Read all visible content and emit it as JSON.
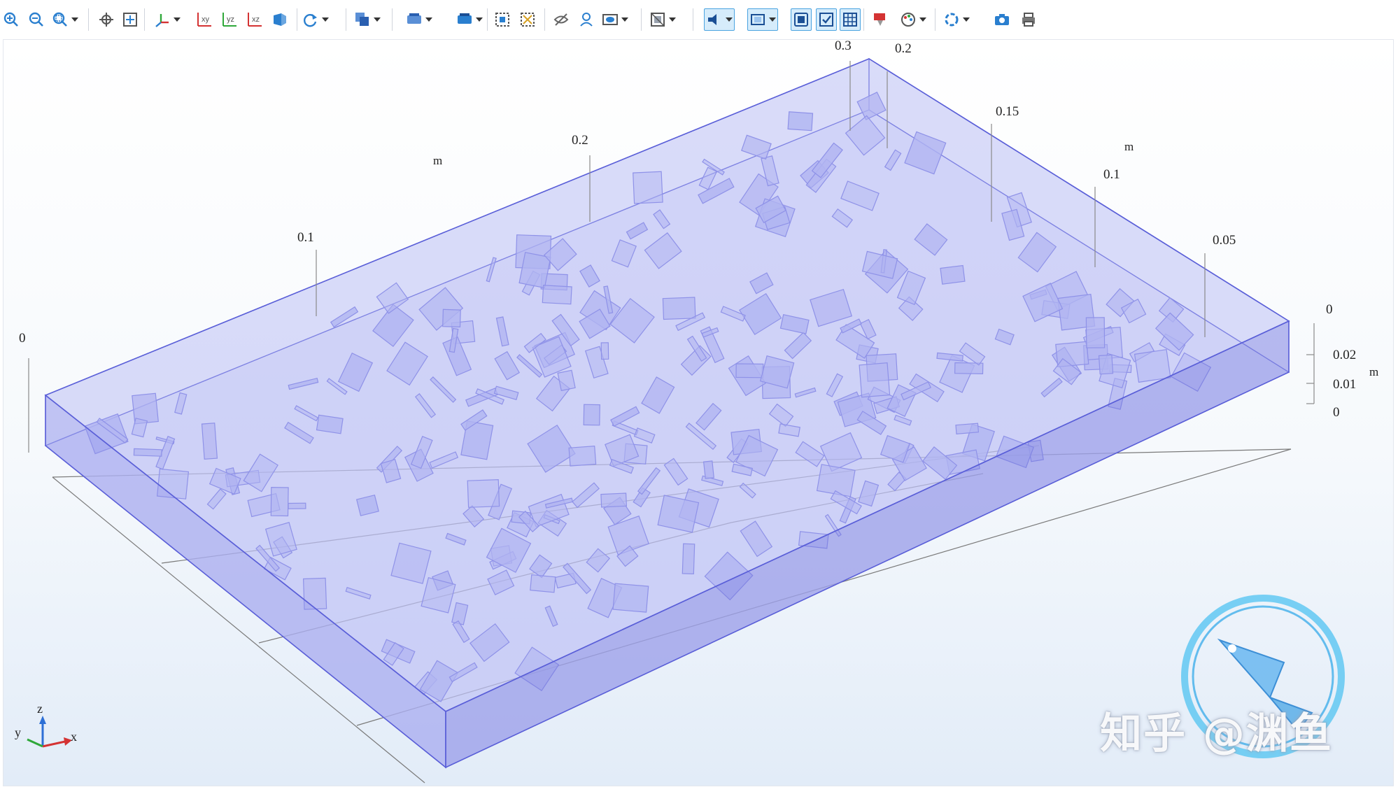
{
  "toolbar": {
    "buttons": [
      {
        "name": "zoom-in-button",
        "icon": "zoom-in-icon"
      },
      {
        "name": "zoom-out-button",
        "icon": "zoom-out-icon"
      },
      {
        "name": "zoom-box-button",
        "icon": "zoom-box-icon",
        "dropdown": true
      },
      {
        "name": "go-to-default-view-button",
        "icon": "center-view-icon"
      },
      {
        "name": "zoom-extents-button",
        "icon": "zoom-extents-icon"
      },
      {
        "name": "view-orientation-button",
        "icon": "axis-orientation-icon",
        "dropdown": true
      },
      {
        "name": "xy-view-button",
        "icon": "xy-plane-icon",
        "label": "xy"
      },
      {
        "name": "yz-view-button",
        "icon": "yz-plane-icon",
        "label": "yz"
      },
      {
        "name": "xz-view-button",
        "icon": "xz-plane-icon",
        "label": "xz"
      },
      {
        "name": "perspective-button",
        "icon": "perspective-icon"
      },
      {
        "name": "rotate-button",
        "icon": "rotate-icon",
        "dropdown": true
      },
      {
        "name": "selection-mode-button",
        "icon": "select-objects-icon",
        "dropdown": true
      },
      {
        "name": "select-box-button",
        "icon": "select-box-icon",
        "dropdown": true
      },
      {
        "name": "select-all-button",
        "icon": "select-all-icon",
        "dropdown": true
      },
      {
        "name": "clear-selection-button",
        "icon": "clear-selection-icon"
      },
      {
        "name": "invert-selection-button",
        "icon": "invert-selection-icon"
      },
      {
        "name": "hide-objects-button",
        "icon": "hide-icon"
      },
      {
        "name": "show-objects-button",
        "icon": "show-icon"
      },
      {
        "name": "visibility-button",
        "icon": "eye-icon",
        "dropdown": true
      },
      {
        "name": "transparency-button",
        "icon": "transparency-icon",
        "dropdown": true
      },
      {
        "name": "scene-light-button",
        "icon": "light-icon",
        "dropdown": true,
        "active": true
      },
      {
        "name": "wireframe-button",
        "icon": "wireframe-icon",
        "dropdown": true,
        "active": true
      },
      {
        "name": "render-mode-button",
        "icon": "render-icon",
        "active": true
      },
      {
        "name": "show-axis-button",
        "icon": "show-axis-icon",
        "active": true
      },
      {
        "name": "show-grid-button",
        "icon": "grid-icon",
        "active": true
      },
      {
        "name": "clear-plot-button",
        "icon": "clear-plot-icon"
      },
      {
        "name": "colors-button",
        "icon": "palette-icon",
        "dropdown": true
      },
      {
        "name": "reset-view-button",
        "icon": "reset-icon",
        "dropdown": true
      },
      {
        "name": "image-snapshot-button",
        "icon": "camera-icon"
      },
      {
        "name": "print-button",
        "icon": "printer-icon"
      }
    ]
  },
  "viewport": {
    "top_axis": {
      "ticks": [
        "0",
        "0.1",
        "0.2",
        "0.3"
      ],
      "unit": "m"
    },
    "right_axis": {
      "ticks": [
        "0.2",
        "0.15",
        "0.1",
        "0.05",
        "0"
      ],
      "unit": "m"
    },
    "z_axis": {
      "ticks": [
        "0.02",
        "0.01",
        "0"
      ],
      "unit": "m"
    },
    "triad": {
      "x": "x",
      "y": "y",
      "z": "z"
    }
  },
  "colors": {
    "box_fill": "#b4b8f4",
    "box_edge": "#5a5fd8",
    "flake_fill": "#a8acef",
    "flake_edge": "#7377e0",
    "axis_line": "#8a8a8a",
    "toolbar_active": "#4aa3e0",
    "toolbar_icon": "#2a7fcf"
  },
  "watermark": {
    "text": "知乎 @渊鱼",
    "logo": "fish-logo"
  }
}
